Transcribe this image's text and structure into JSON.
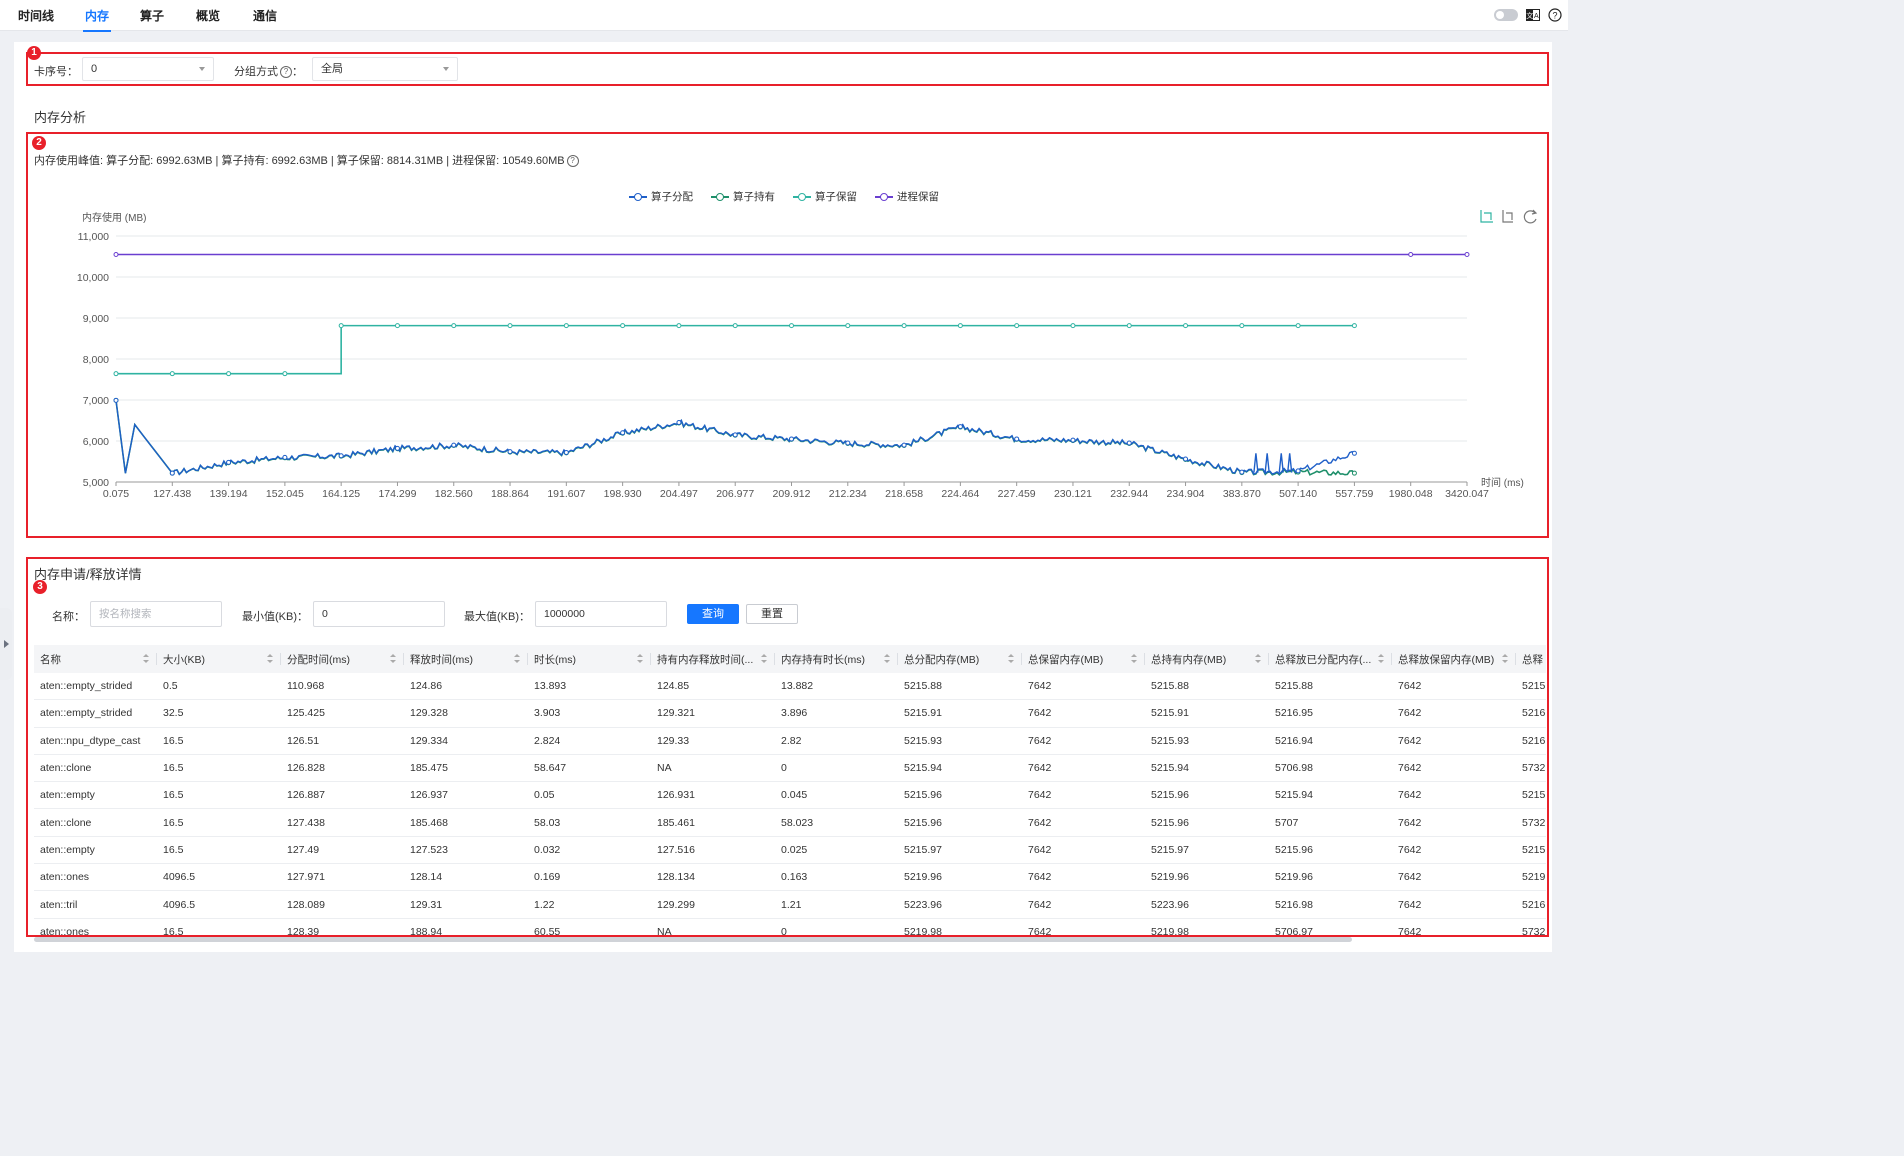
{
  "nav": {
    "tabs": [
      {
        "label": "时间线"
      },
      {
        "label": "内存",
        "active": true
      },
      {
        "label": "算子"
      },
      {
        "label": "概览"
      },
      {
        "label": "通信"
      }
    ],
    "icons": [
      "theme-toggle",
      "language-icon",
      "help-icon"
    ]
  },
  "annotations": [
    "1",
    "2",
    "3"
  ],
  "filters": {
    "card_label": "卡序号：",
    "card_value": "0",
    "group_label": "分组方式",
    "group_colon": "：",
    "group_value": "全局"
  },
  "analysis": {
    "title": "内存分析",
    "peak_text": "内存使用峰值: 算子分配: 6992.63MB | 算子持有: 6992.63MB | 算子保留: 8814.31MB | 进程保留: 10549.60MB"
  },
  "colors": {
    "accent": "#1677ff",
    "annotation_red": "#e8202a",
    "series_alloc": "#1f5fc8",
    "series_hold": "#1e8f6a",
    "series_reserve": "#2fb3a2",
    "series_process": "#6a3fd0"
  },
  "chart_data": {
    "type": "line",
    "ylabel": "内存使用 (MB)",
    "xlabel": "时间 (ms)",
    "ylim": [
      5000,
      11000
    ],
    "yticks": [
      "5,000",
      "6,000",
      "7,000",
      "8,000",
      "9,000",
      "10,000",
      "11,000"
    ],
    "ytick_values": [
      5000,
      6000,
      7000,
      8000,
      9000,
      10000,
      11000
    ],
    "x": [
      "0.075",
      "127.438",
      "139.194",
      "152.045",
      "164.125",
      "174.299",
      "182.560",
      "188.864",
      "191.607",
      "198.930",
      "204.497",
      "206.977",
      "209.912",
      "212.234",
      "218.658",
      "224.464",
      "227.459",
      "230.121",
      "232.944",
      "234.904",
      "383.870",
      "507.140",
      "557.759",
      "1980.048",
      "3420.047"
    ],
    "legend_position": "top-center",
    "grid": true,
    "series": [
      {
        "name": "算子分配",
        "color": "#1f5fc8",
        "values": [
          6992,
          5215,
          5480,
          5600,
          5640,
          5820,
          5900,
          5740,
          5720,
          6200,
          6450,
          6150,
          6050,
          5950,
          5900,
          6350,
          6050,
          6020,
          5950,
          5560,
          5240,
          5270,
          5700,
          null,
          null
        ]
      },
      {
        "name": "算子持有",
        "color": "#1e8f6a",
        "values": [
          6992,
          5215,
          5470,
          5590,
          5630,
          5810,
          5890,
          5730,
          5710,
          6190,
          6440,
          6140,
          6040,
          5940,
          5890,
          6340,
          6040,
          6010,
          5940,
          5550,
          5230,
          5240,
          5215,
          null,
          null
        ]
      },
      {
        "name": "算子保留",
        "color": "#2fb3a2",
        "values": [
          7642,
          7642,
          7642,
          7642,
          8814,
          8814,
          8814,
          8814,
          8814,
          8814,
          8814,
          8814,
          8814,
          8814,
          8814,
          8814,
          8814,
          8814,
          8814,
          8814,
          8814,
          8814,
          8814,
          null,
          null
        ]
      },
      {
        "name": "进程保留",
        "color": "#6a3fd0",
        "values": [
          10549,
          10549,
          10549,
          10549,
          10549,
          10549,
          10549,
          10549,
          10549,
          10549,
          10549,
          10549,
          10549,
          10549,
          10549,
          10549,
          10549,
          10549,
          10549,
          10549,
          10549,
          10549,
          10549,
          10549,
          10549
        ]
      }
    ],
    "toolbox": [
      "zoom-icon",
      "zoom-reset-icon",
      "restore-icon"
    ]
  },
  "details": {
    "title": "内存申请/释放详情",
    "name_label": "名称：",
    "name_placeholder": "按名称搜索",
    "min_label": "最小值(KB)：",
    "min_value": "0",
    "max_label": "最大值(KB)：",
    "max_value": "1000000",
    "query_label": "查询",
    "reset_label": "重置",
    "columns": [
      "名称",
      "大小(KB)",
      "分配时间(ms)",
      "释放时间(ms)",
      "时长(ms)",
      "持有内存释放时间(...",
      "内存持有时长(ms)",
      "总分配内存(MB)",
      "总保留内存(MB)",
      "总持有内存(MB)",
      "总释放已分配内存(...",
      "总释放保留内存(MB)",
      "总释"
    ],
    "rows": [
      [
        "aten::empty_strided",
        "0.5",
        "110.968",
        "124.86",
        "13.893",
        "124.85",
        "13.882",
        "5215.88",
        "7642",
        "5215.88",
        "5215.88",
        "7642",
        "5215"
      ],
      [
        "aten::empty_strided",
        "32.5",
        "125.425",
        "129.328",
        "3.903",
        "129.321",
        "3.896",
        "5215.91",
        "7642",
        "5215.91",
        "5216.95",
        "7642",
        "5216"
      ],
      [
        "aten::npu_dtype_cast",
        "16.5",
        "126.51",
        "129.334",
        "2.824",
        "129.33",
        "2.82",
        "5215.93",
        "7642",
        "5215.93",
        "5216.94",
        "7642",
        "5216"
      ],
      [
        "aten::clone",
        "16.5",
        "126.828",
        "185.475",
        "58.647",
        "NA",
        "0",
        "5215.94",
        "7642",
        "5215.94",
        "5706.98",
        "7642",
        "5732"
      ],
      [
        "aten::empty",
        "16.5",
        "126.887",
        "126.937",
        "0.05",
        "126.931",
        "0.045",
        "5215.96",
        "7642",
        "5215.96",
        "5215.94",
        "7642",
        "5215"
      ],
      [
        "aten::clone",
        "16.5",
        "127.438",
        "185.468",
        "58.03",
        "185.461",
        "58.023",
        "5215.96",
        "7642",
        "5215.96",
        "5707",
        "7642",
        "5732"
      ],
      [
        "aten::empty",
        "16.5",
        "127.49",
        "127.523",
        "0.032",
        "127.516",
        "0.025",
        "5215.97",
        "7642",
        "5215.97",
        "5215.96",
        "7642",
        "5215"
      ],
      [
        "aten::ones",
        "4096.5",
        "127.971",
        "128.14",
        "0.169",
        "128.134",
        "0.163",
        "5219.96",
        "7642",
        "5219.96",
        "5219.96",
        "7642",
        "5219"
      ],
      [
        "aten::tril",
        "4096.5",
        "128.089",
        "129.31",
        "1.22",
        "129.299",
        "1.21",
        "5223.96",
        "7642",
        "5223.96",
        "5216.98",
        "7642",
        "5216"
      ],
      [
        "aten::ones",
        "16.5",
        "128.39",
        "188.94",
        "60.55",
        "NA",
        "0",
        "5219.98",
        "7642",
        "5219.98",
        "5706.97",
        "7642",
        "5732"
      ]
    ]
  }
}
